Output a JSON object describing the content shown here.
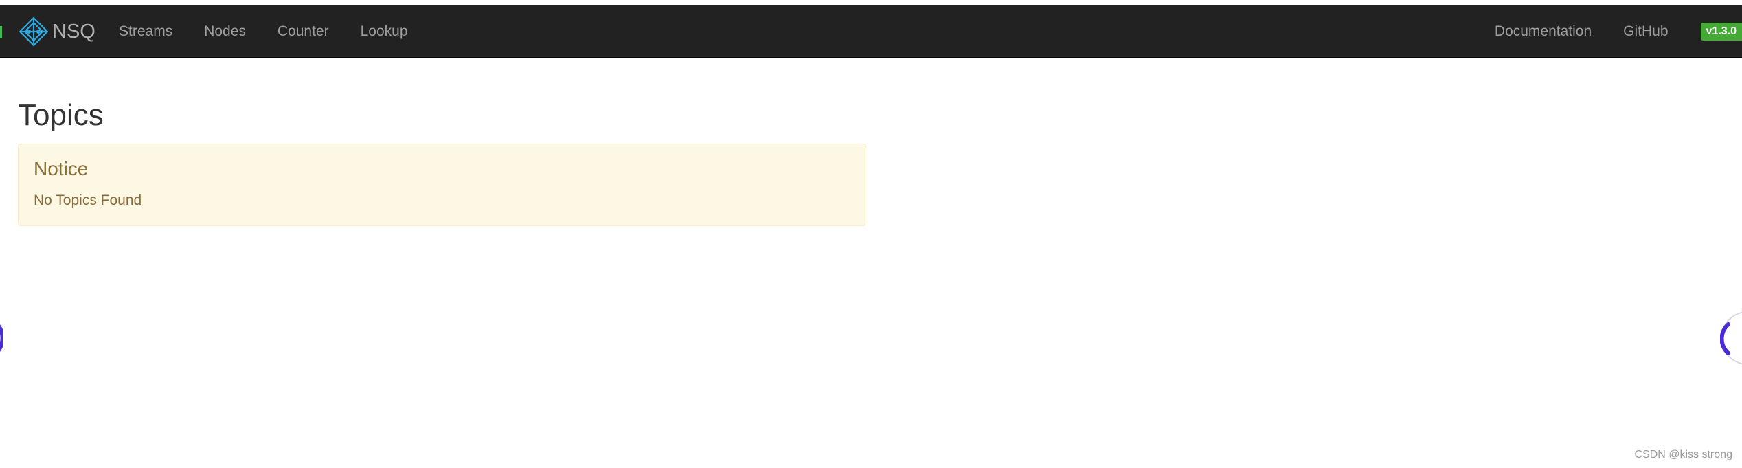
{
  "navbar": {
    "brand_name": "NSQ",
    "logo_icon": "nsq-logo-icon",
    "left_links": [
      {
        "label": "Streams"
      },
      {
        "label": "Nodes"
      },
      {
        "label": "Counter"
      },
      {
        "label": "Lookup"
      }
    ],
    "right_links": [
      {
        "label": "Documentation"
      },
      {
        "label": "GitHub"
      }
    ],
    "version": "v1.3.0"
  },
  "main": {
    "title": "Topics",
    "notice": {
      "title": "Notice",
      "message": "No Topics Found"
    }
  },
  "watermark": "CSDN @kiss strong",
  "colors": {
    "navbar_bg": "#222222",
    "nav_text": "#9d9d9d",
    "version_badge": "#45a935",
    "notice_bg": "#fcf8e3",
    "notice_border": "#faebcc",
    "notice_text": "#8a6d3b",
    "logo_blue": "#2ea8e0"
  }
}
